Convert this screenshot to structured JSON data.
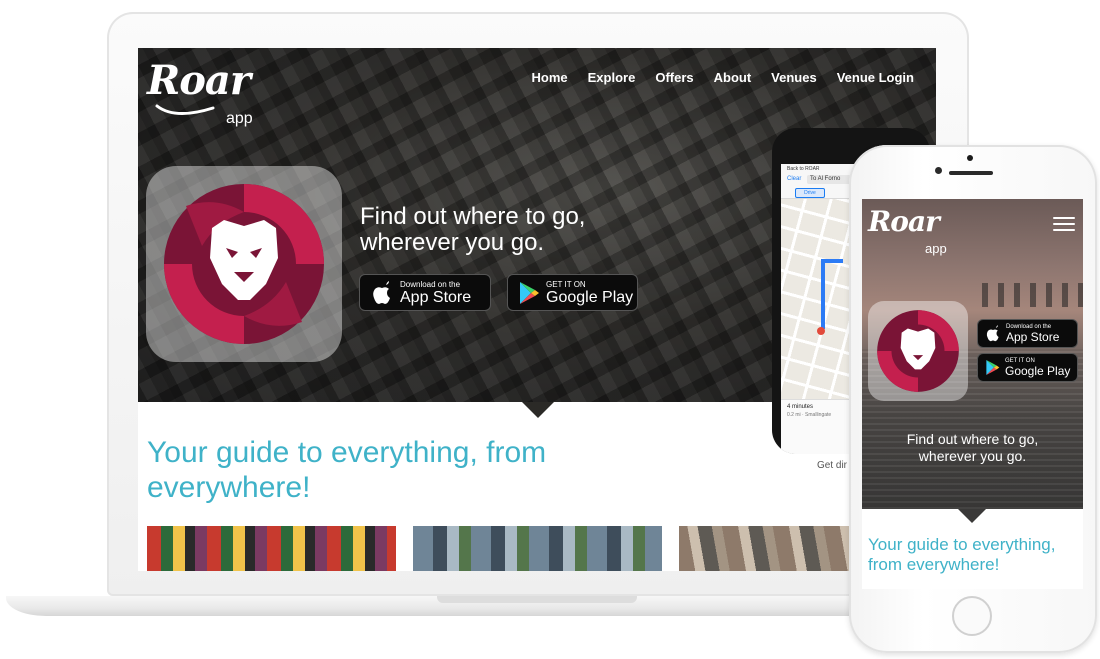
{
  "brand": {
    "logo_word": "Roar",
    "logo_sub": "app"
  },
  "desktop": {
    "nav": [
      "Home",
      "Explore",
      "Offers",
      "About",
      "Venues",
      "Venue Login"
    ],
    "tagline_line1": "Find out where to go,",
    "tagline_line2": "wherever you go.",
    "app_store": {
      "small": "Download on the",
      "big": "App Store"
    },
    "google_play": {
      "small": "GET IT ON",
      "big": "Google Play"
    },
    "guide_title": "Your guide to everything, from everywhere!"
  },
  "map_phone": {
    "back_label": "Back to ROAR",
    "clear_label": "Clear",
    "to_field": "To Al Forno",
    "mode_label": "Drive",
    "minutes": "4 minutes",
    "distance": "0.2 mi · Smallingate",
    "get_directions_partial": "Get dir"
  },
  "mobile": {
    "app_store": {
      "small": "Download on the",
      "big": "App Store"
    },
    "google_play": {
      "small": "GET IT ON",
      "big": "Google Play"
    },
    "tagline_line1": "Find out where to go,",
    "tagline_line2": "wherever you go.",
    "guide_title": "Your guide to everything, from everywhere!"
  },
  "colors": {
    "accent_teal": "#3fb2c8",
    "lion_crimson": "#c4204e",
    "lion_maroon": "#7a1436",
    "map_route": "#2c7bf5"
  }
}
